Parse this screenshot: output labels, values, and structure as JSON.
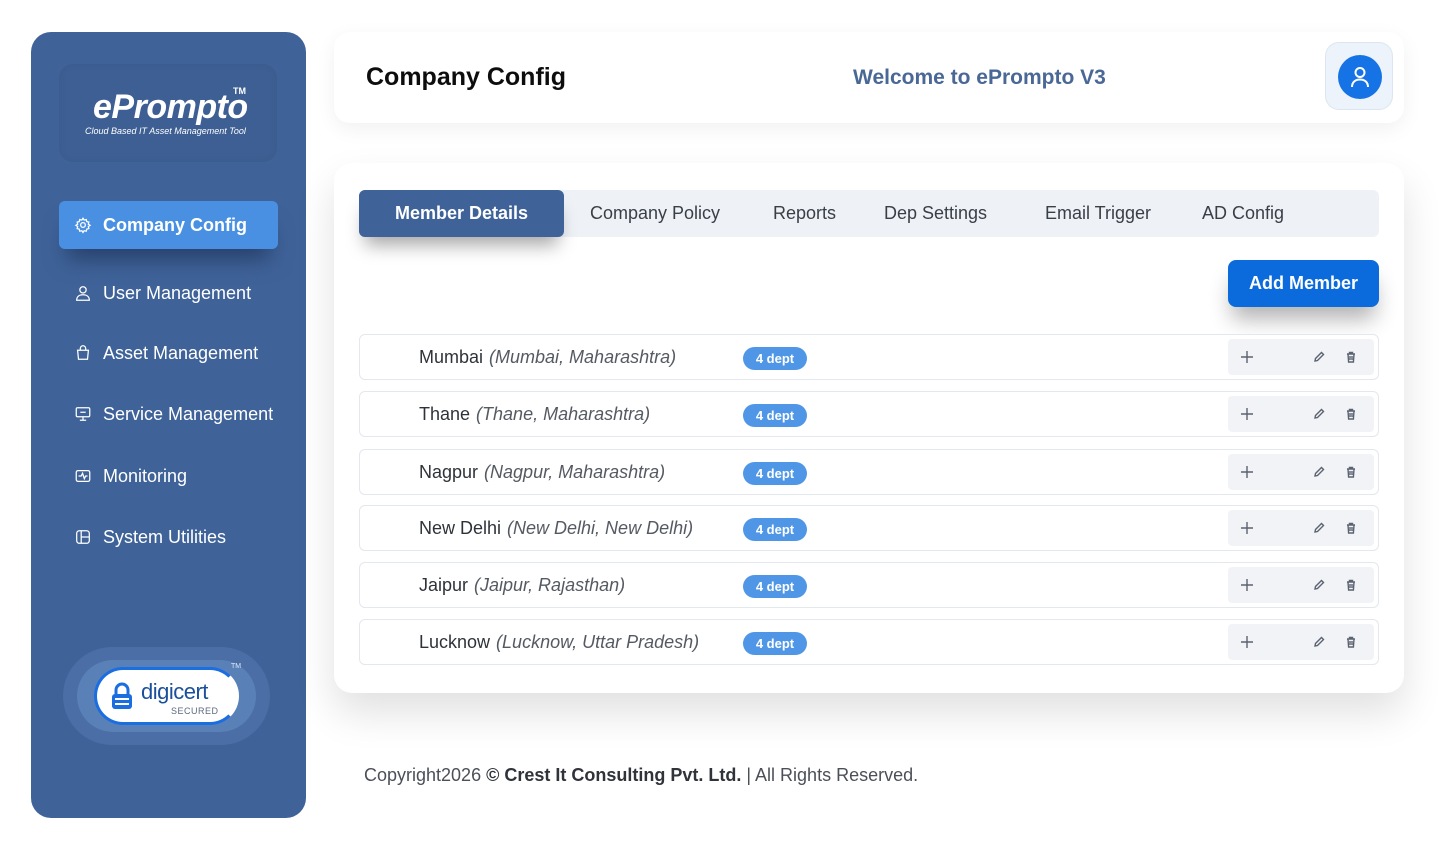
{
  "brand": {
    "name": "ePrompto",
    "tm": "TM",
    "tagline": "Cloud Based IT Asset Management Tool"
  },
  "sidebar": {
    "items": [
      {
        "label": "Company Config",
        "icon": "gear-icon",
        "active": true
      },
      {
        "label": "User Management",
        "icon": "user-icon"
      },
      {
        "label": "Asset Management",
        "icon": "bag-icon"
      },
      {
        "label": "Service Management",
        "icon": "monitor-icon"
      },
      {
        "label": "Monitoring",
        "icon": "monitoring-icon"
      },
      {
        "label": "System Utilities",
        "icon": "utilities-icon"
      }
    ],
    "badge": {
      "name": "digicert",
      "secured": "SECURED",
      "tm": "TM"
    }
  },
  "header": {
    "title": "Company Config",
    "welcome": "Welcome to ePrompto V3"
  },
  "tabs": [
    "Member Details",
    "Company Policy",
    "Reports",
    "Dep Settings",
    "Email Trigger",
    "AD Config"
  ],
  "add_member_label": "Add Member",
  "locations": [
    {
      "city": "Mumbai",
      "region": "(Mumbai, Maharashtra)",
      "dept": "4 dept"
    },
    {
      "city": "Thane",
      "region": "(Thane, Maharashtra)",
      "dept": "4 dept"
    },
    {
      "city": "Nagpur",
      "region": "(Nagpur, Maharashtra)",
      "dept": "4 dept"
    },
    {
      "city": "New Delhi",
      "region": "(New Delhi, New Delhi)",
      "dept": "4 dept"
    },
    {
      "city": "Jaipur",
      "region": "(Jaipur, Rajasthan)",
      "dept": "4 dept"
    },
    {
      "city": "Lucknow",
      "region": "(Lucknow, Uttar Pradesh)",
      "dept": "4 dept"
    }
  ],
  "footer": {
    "prefix": "Copyright2026 ",
    "company": "© Crest It Consulting Pvt. Ltd.",
    "suffix": " | All Rights Reserved."
  },
  "colors": {
    "sidebar": "#3f6399",
    "accent": "#4a90e2",
    "primary_button": "#0b6bdc",
    "badge": "#4f97e6"
  }
}
